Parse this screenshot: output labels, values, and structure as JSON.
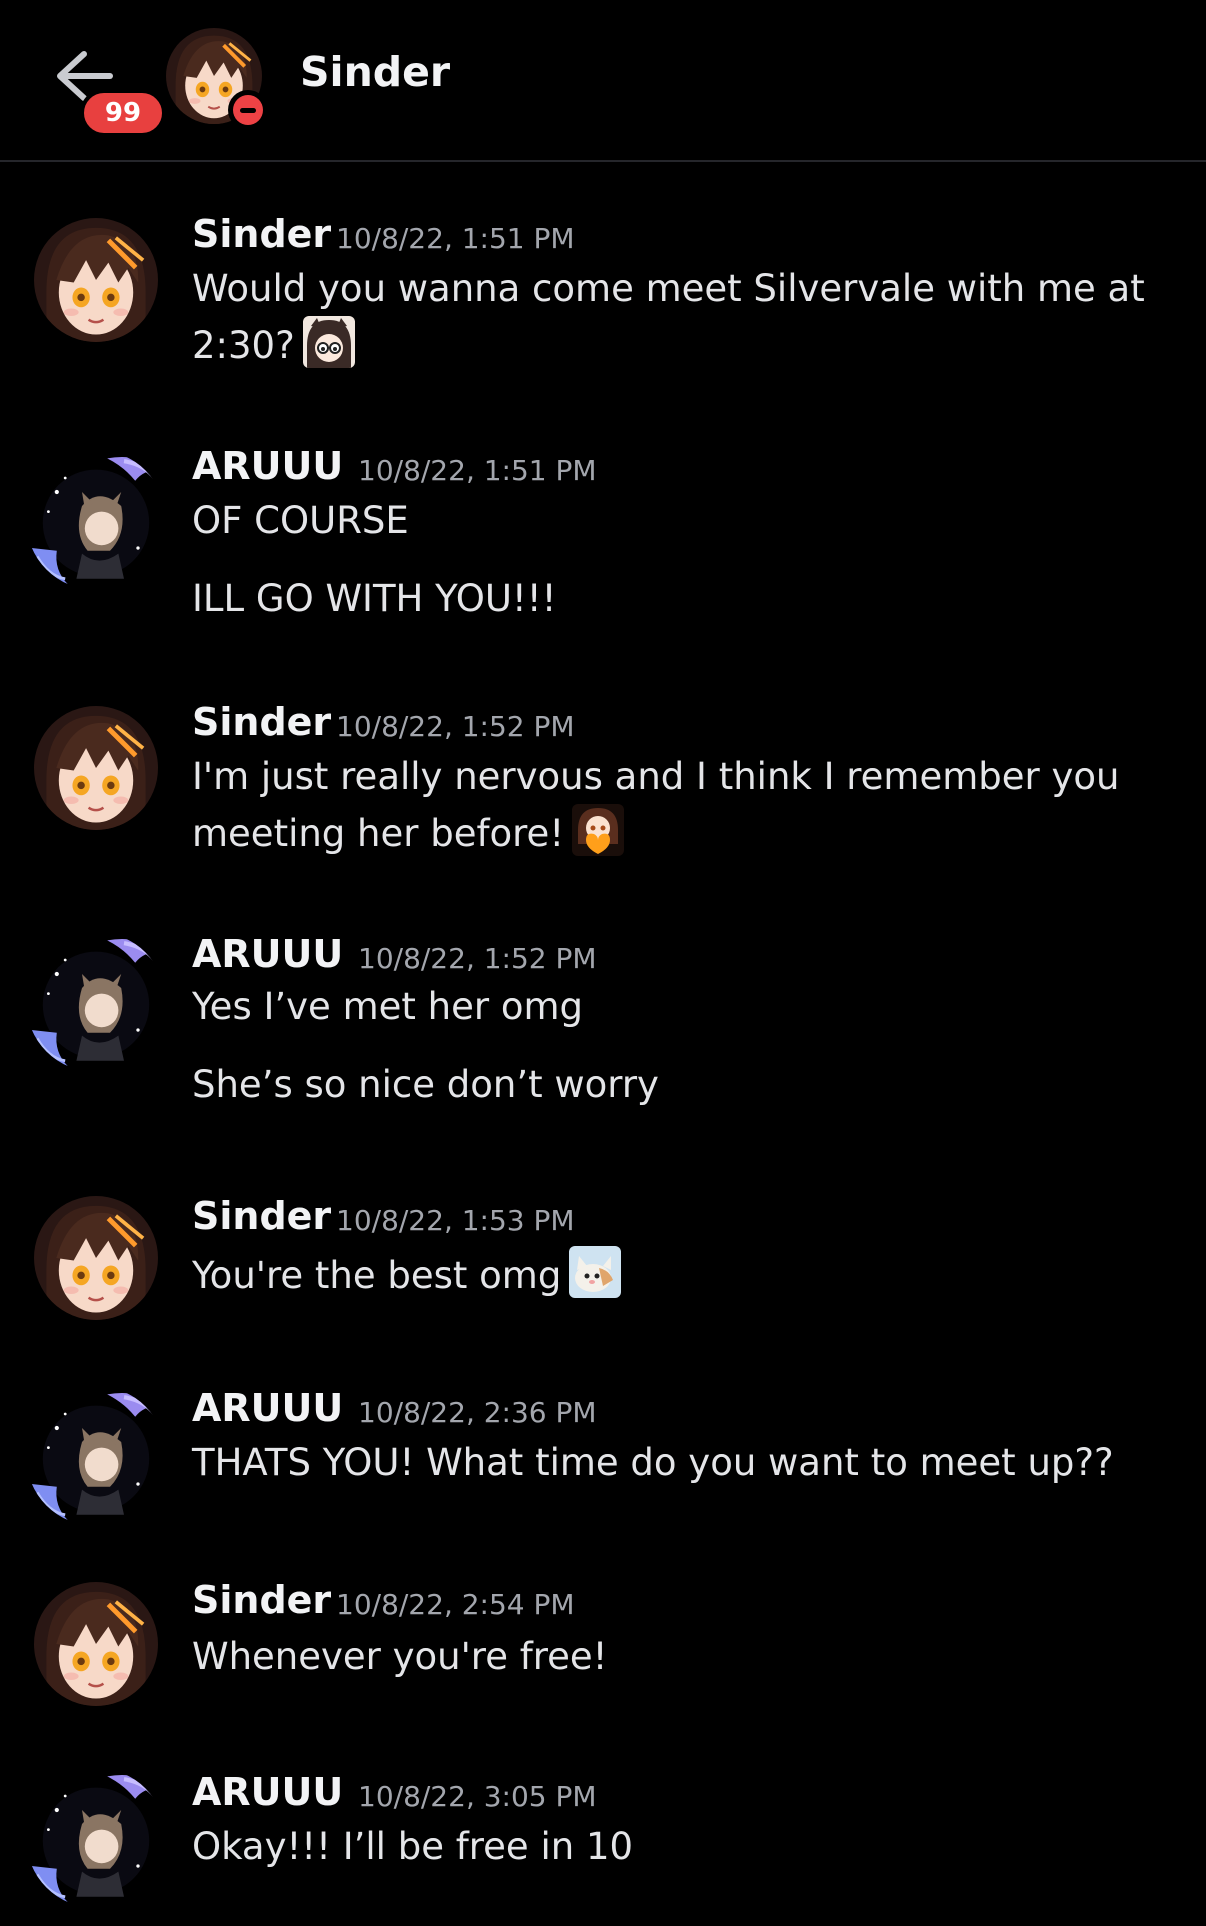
{
  "header": {
    "title": "Sinder",
    "unread_badge": "99",
    "status": "do-not-disturb"
  },
  "colors": {
    "background": "#000000",
    "badge": "#e8403f",
    "dnd": "#ed4245",
    "author": "#f2f3f5",
    "timestamp": "#a3a6ad",
    "text": "#e4e5e8"
  },
  "messages": [
    {
      "author": "Sinder",
      "timestamp": "10/8/22, 1:51 PM",
      "lines": [
        "Would you wanna come meet Silvervale with me at",
        "2:30?"
      ],
      "emoji": "anime-girl-emoji"
    },
    {
      "author": "ARUUU",
      "timestamp": "10/8/22, 1:51 PM",
      "lines": [
        "OF COURSE",
        "ILL GO WITH YOU!!!"
      ]
    },
    {
      "author": "Sinder",
      "timestamp": "10/8/22, 1:52 PM",
      "lines": [
        "I'm just really nervous and I think I remember you",
        "meeting her before!"
      ],
      "emoji": "heart-girl-emoji"
    },
    {
      "author": "ARUUU",
      "timestamp": "10/8/22, 1:52 PM",
      "lines": [
        "Yes I’ve met her omg",
        "She’s so nice don’t worry"
      ]
    },
    {
      "author": "Sinder",
      "timestamp": "10/8/22, 1:53 PM",
      "lines": [
        "You're the best omg"
      ],
      "emoji": "cat-emoji"
    },
    {
      "author": "ARUUU",
      "timestamp": "10/8/22, 2:36 PM",
      "lines": [
        "THATS YOU! What time do you want to meet up??"
      ]
    },
    {
      "author": "Sinder",
      "timestamp": "10/8/22, 2:54 PM",
      "lines": [
        "Whenever you're free!"
      ]
    },
    {
      "author": "ARUUU",
      "timestamp": "10/8/22, 3:05 PM",
      "lines": [
        "Okay!!! I’ll be free in 10"
      ]
    }
  ]
}
